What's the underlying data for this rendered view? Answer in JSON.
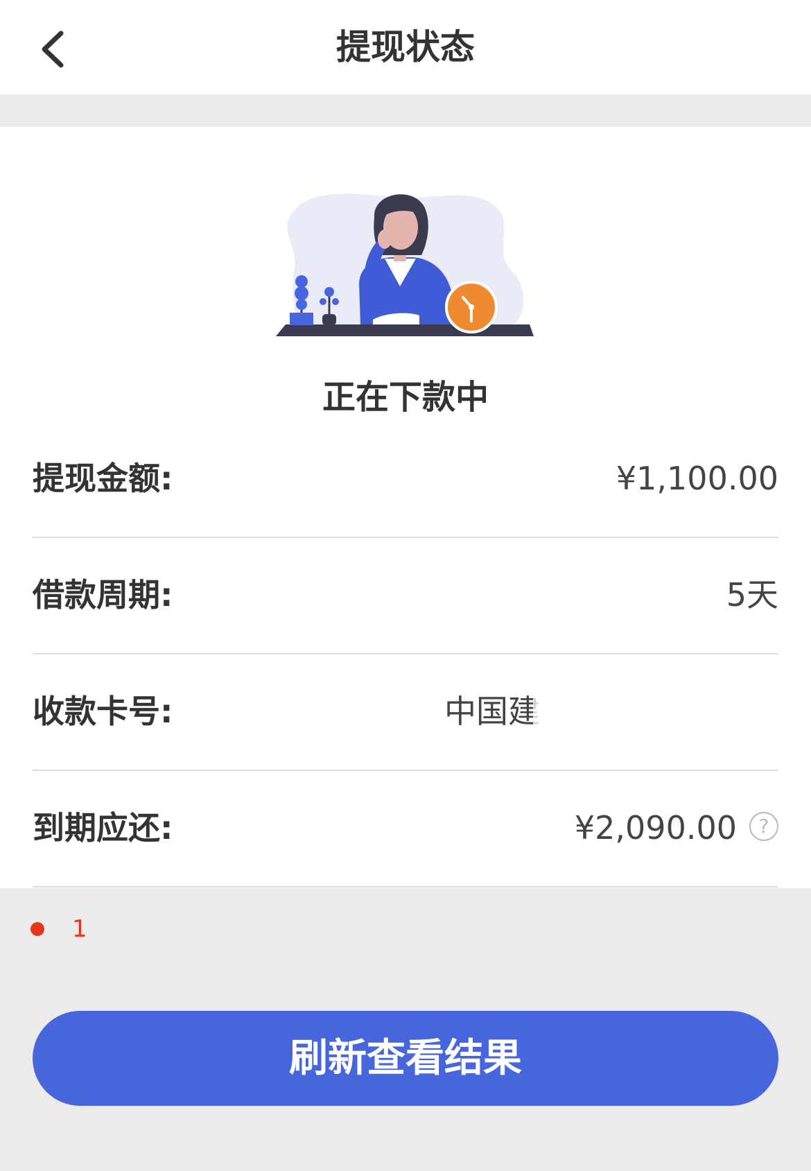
{
  "header": {
    "title": "提现状态",
    "back_icon": "chevron-left-icon"
  },
  "status": {
    "text": "正在下款中",
    "illustration": "woman-waiting-clock-illustration"
  },
  "details": [
    {
      "label": "提现金额:",
      "value": "¥1,100.00"
    },
    {
      "label": "借款周期:",
      "value": "5天"
    },
    {
      "label": "收款卡号:",
      "value": "中国建"
    },
    {
      "label": "到期应还:",
      "value": "¥2,090.00",
      "help_icon": "question-circle-icon"
    }
  ],
  "help_glyph": "?",
  "notice": {
    "text": "1",
    "color": "#e8351f"
  },
  "actions": {
    "refresh_label": "刷新查看结果"
  },
  "colors": {
    "accent": "#4765dc",
    "background": "#ebebeb",
    "clock_orange": "#f08a30"
  }
}
